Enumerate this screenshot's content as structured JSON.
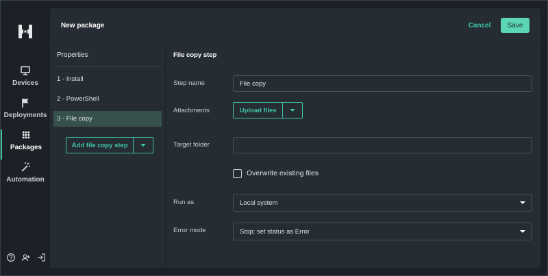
{
  "nav": {
    "items": [
      {
        "label": "Devices",
        "icon": "monitor-icon"
      },
      {
        "label": "Deployments",
        "icon": "flag-icon"
      },
      {
        "label": "Packages",
        "icon": "grid-icon",
        "active": true
      },
      {
        "label": "Automation",
        "icon": "magic-wand-icon"
      }
    ],
    "bottom_icons": [
      "help-icon",
      "add-user-icon",
      "logout-icon"
    ]
  },
  "header": {
    "title": "New package",
    "cancel_label": "Cancel",
    "save_label": "Save"
  },
  "properties": {
    "title": "Properties",
    "steps": [
      {
        "label": "1 - Install"
      },
      {
        "label": "2 - PowerShell"
      },
      {
        "label": "3 - File copy",
        "selected": true
      }
    ],
    "add_step_label": "Add file copy step"
  },
  "form": {
    "section_title": "File copy step",
    "step_name_label": "Step name",
    "step_name_value": "File copy",
    "attachments_label": "Attachments",
    "upload_label": "Upload files",
    "target_folder_label": "Target folder",
    "target_folder_value": "",
    "overwrite_label": "Overwrite existing files",
    "overwrite_checked": false,
    "run_as_label": "Run as",
    "run_as_value": "Local system",
    "error_mode_label": "Error mode",
    "error_mode_value": "Stop; set status as Error"
  },
  "colors": {
    "accent": "#3fc4a6",
    "save_bg": "#5dd6b5",
    "panel_bg": "#262c33",
    "page_bg": "#1c2127",
    "selected_row": "#36504b"
  }
}
